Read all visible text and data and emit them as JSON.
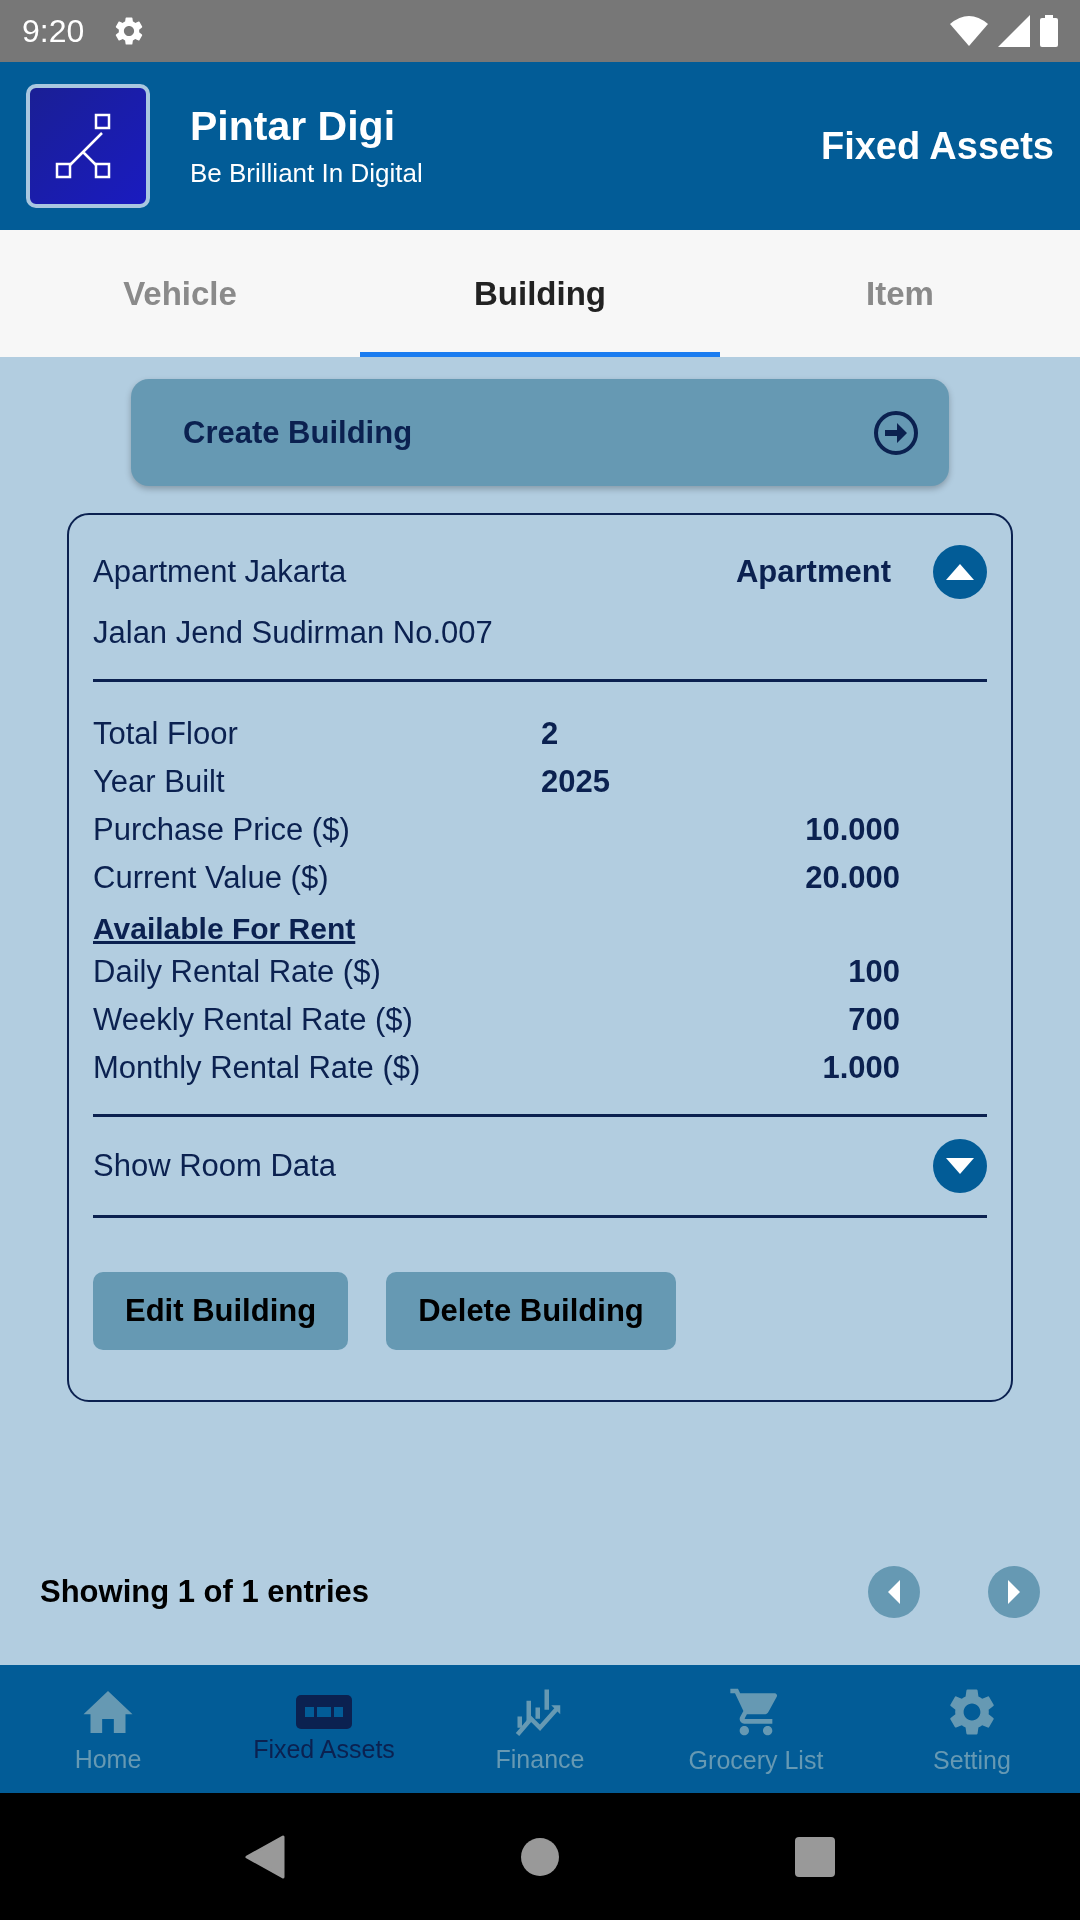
{
  "status_bar": {
    "time": "9:20"
  },
  "header": {
    "app_name": "Pintar Digi",
    "tagline": "Be Brilliant In Digital",
    "page_title": "Fixed Assets"
  },
  "tabs": [
    {
      "label": "Vehicle",
      "selected": false
    },
    {
      "label": "Building",
      "selected": true
    },
    {
      "label": "Item",
      "selected": false
    }
  ],
  "create_button": {
    "label": "Create Building"
  },
  "building_card": {
    "name": "Apartment Jakarta",
    "type": "Apartment",
    "address": "Jalan Jend Sudirman No.007",
    "expanded": true,
    "details": [
      {
        "label": "Total Floor",
        "value": "2",
        "kind": "count"
      },
      {
        "label": "Year Built",
        "value": "2025",
        "kind": "count"
      },
      {
        "label": "Purchase Price ($)",
        "value": "10.000",
        "kind": "amount"
      },
      {
        "label": "Current Value ($)",
        "value": "20.000",
        "kind": "amount"
      }
    ],
    "rental_heading": "Available For Rent",
    "rental": [
      {
        "label": "Daily Rental Rate ($)",
        "value": "100",
        "kind": "amount"
      },
      {
        "label": "Weekly Rental Rate ($)",
        "value": "700",
        "kind": "amount"
      },
      {
        "label": "Monthly Rental Rate ($)",
        "value": "1.000",
        "kind": "amount"
      }
    ],
    "room_data": {
      "label": "Show Room Data",
      "expanded": false
    },
    "buttons": [
      "Edit Building",
      "Delete Building"
    ]
  },
  "pagination": {
    "summary": "Showing 1 of 1 entries"
  },
  "bottom_nav": [
    {
      "label": "Home",
      "kind": "home",
      "selected": false
    },
    {
      "label": "Fixed Assets",
      "kind": "assets",
      "selected": true
    },
    {
      "label": "Finance",
      "kind": "finance",
      "selected": false
    },
    {
      "label": "Grocery List",
      "kind": "cart",
      "selected": false
    },
    {
      "label": "Setting",
      "kind": "gear",
      "selected": false
    }
  ]
}
